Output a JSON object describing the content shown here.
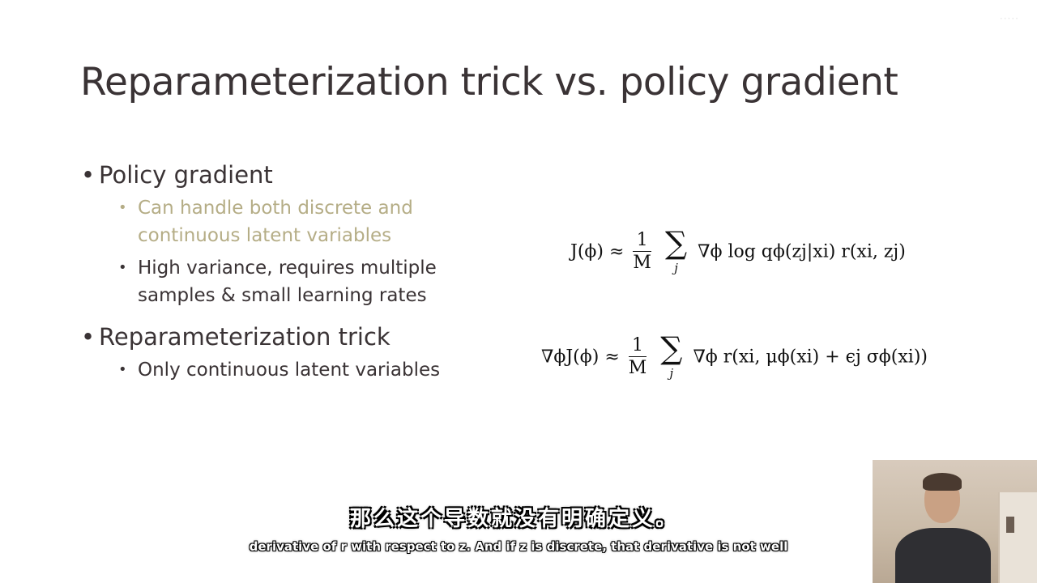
{
  "watermark": "·····",
  "slide": {
    "title": "Reparameterization trick vs. policy gradient",
    "bullets": [
      {
        "label": "Policy gradient",
        "sub": [
          "Can handle both discrete and continuous latent variables",
          "High variance, requires multiple samples & small learning rates"
        ]
      },
      {
        "label": "Reparameterization trick",
        "sub": [
          "Only continuous latent variables"
        ]
      }
    ],
    "bullet_char": "•"
  },
  "equations": {
    "policy_gradient": {
      "lhs": "J(ϕ) ≈",
      "frac_num": "1",
      "frac_den": "M",
      "sum_symbol": "∑",
      "sum_index": "j",
      "rhs": "∇ϕ log qϕ(zj|xi) r(xi, zj)"
    },
    "reparameterization": {
      "lhs": "∇ϕJ(ϕ) ≈",
      "frac_num": "1",
      "frac_den": "M",
      "sum_symbol": "∑",
      "sum_index": "j",
      "rhs": "∇ϕ r(xi, μϕ(xi) + ϵj σϕ(xi))"
    }
  },
  "subtitles": {
    "chinese": "那么这个导数就没有明确定义。",
    "english": "derivative of r with respect to z. And if z is discrete, that derivative is not well"
  },
  "colors": {
    "text": "#3a3335",
    "faded_text": "#b5ad86",
    "background": "#ffffff"
  }
}
